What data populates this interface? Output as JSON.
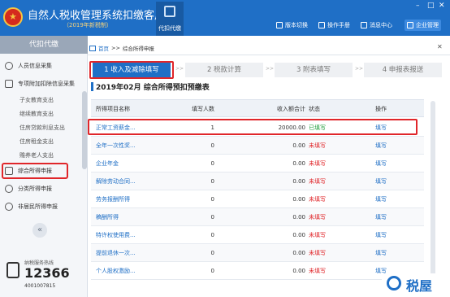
{
  "header": {
    "title": "自然人税收管理系统扣缴客户端",
    "version": "（2019年新税制）",
    "tool_label": "代扣代缴",
    "links": [
      "版本切换",
      "操作手册",
      "消息中心",
      "企业管理"
    ],
    "window_controls": [
      "–",
      "□",
      "✕"
    ]
  },
  "sidebar": {
    "title": "代扣代缴",
    "items": [
      {
        "label": "人员信息采集",
        "icon": "person-icon"
      },
      {
        "label": "专项附加扣除信息采集",
        "icon": "list-icon"
      }
    ],
    "sub_items": [
      "子女教育支出",
      "继续教育支出",
      "住房贷款利息支出",
      "住房租金支出",
      "赡养老人支出"
    ],
    "lower_items": [
      {
        "label": "综合所得申报",
        "icon": "layers-icon"
      },
      {
        "label": "分类所得申报",
        "icon": "clock-icon"
      },
      {
        "label": "非居民所得申报",
        "icon": "person-icon"
      }
    ],
    "collapse_glyph": "«",
    "hotline": {
      "label": "纳税服务热线",
      "number": "12366",
      "tel": "4001007815"
    }
  },
  "breadcrumb": {
    "home": "首页",
    "separator": ">>",
    "current": "综合所得申报",
    "close": "✕"
  },
  "steps": [
    {
      "label": "1 收入及减除填写",
      "active": true
    },
    {
      "label": "2 税款计算",
      "active": false
    },
    {
      "label": "3 附表填写",
      "active": false
    },
    {
      "label": "4 申报表报送",
      "active": false
    }
  ],
  "step_separator": ">>",
  "section_title": "2019年02月  综合所得预扣预缴表",
  "table": {
    "headers": [
      "所得项目名称",
      "填写人数",
      "收入额合计",
      "状态",
      "操作"
    ],
    "rows": [
      {
        "name": "正常工资薪金...",
        "count": "1",
        "amount": "20000.00",
        "status": "已填写",
        "done": true,
        "op": "填写"
      },
      {
        "name": "全年一次性奖...",
        "count": "0",
        "amount": "0.00",
        "status": "未填写",
        "done": false,
        "op": "填写"
      },
      {
        "name": "企业年金",
        "count": "0",
        "amount": "0.00",
        "status": "未填写",
        "done": false,
        "op": "填写"
      },
      {
        "name": "解除劳动合同...",
        "count": "0",
        "amount": "0.00",
        "status": "未填写",
        "done": false,
        "op": "填写"
      },
      {
        "name": "劳务报酬所得",
        "count": "0",
        "amount": "0.00",
        "status": "未填写",
        "done": false,
        "op": "填写"
      },
      {
        "name": "稿酬所得",
        "count": "0",
        "amount": "0.00",
        "status": "未填写",
        "done": false,
        "op": "填写"
      },
      {
        "name": "特许权使用费...",
        "count": "0",
        "amount": "0.00",
        "status": "未填写",
        "done": false,
        "op": "填写"
      },
      {
        "name": "提前退休一次...",
        "count": "0",
        "amount": "0.00",
        "status": "未填写",
        "done": false,
        "op": "填写"
      },
      {
        "name": "个人股权激励...",
        "count": "0",
        "amount": "0.00",
        "status": "未填写",
        "done": false,
        "op": "填写"
      }
    ]
  },
  "watermark": {
    "text": "税屋"
  },
  "colors": {
    "primary": "#1f6fc6",
    "highlight": "#e0262a",
    "done": "#1f9e3a",
    "pending": "#e0262a"
  }
}
